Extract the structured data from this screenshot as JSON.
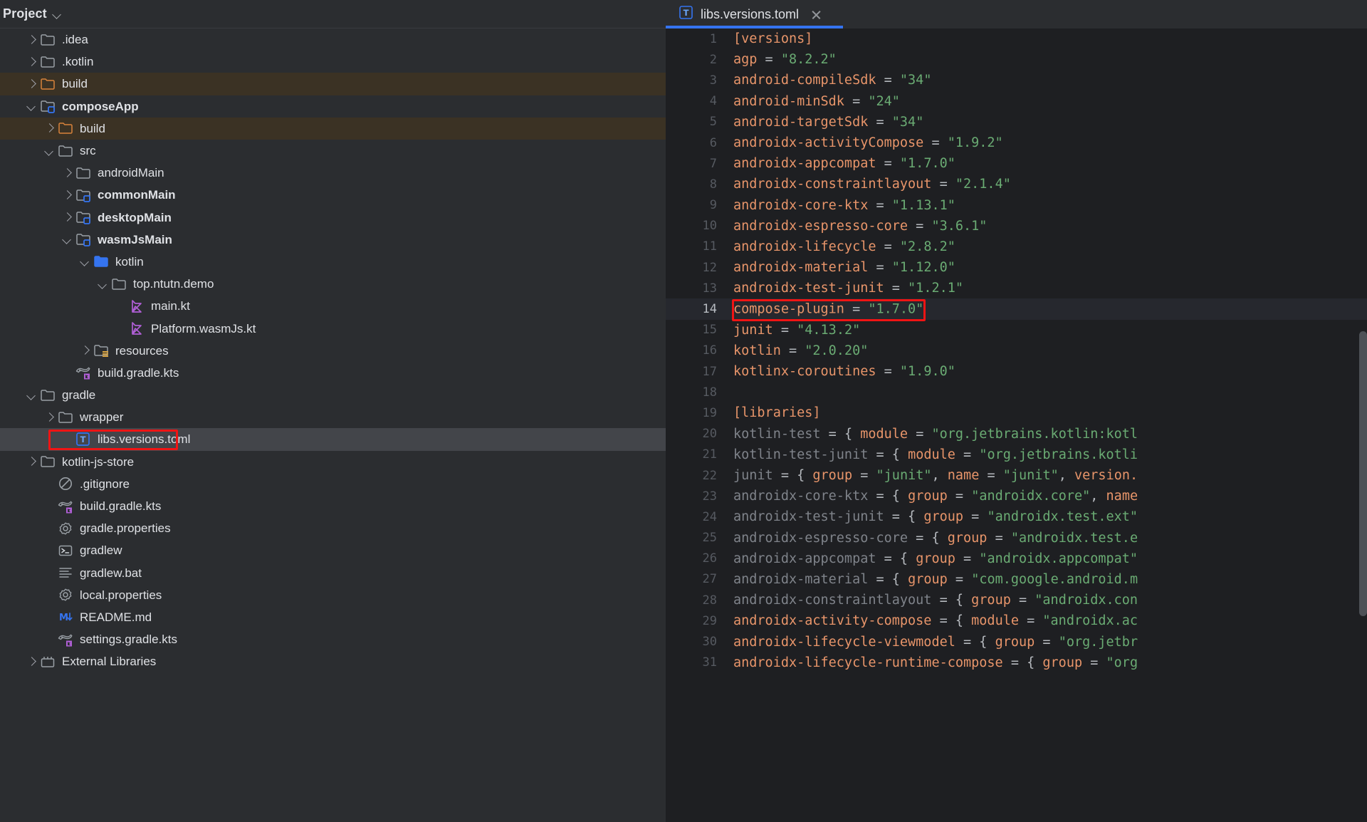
{
  "sidebar": {
    "header": {
      "title": "Project",
      "collapse_icon": "chevron-down-icon"
    },
    "items": [
      {
        "label": ".idea",
        "indent": 1,
        "arrow": "right",
        "icon": "folder",
        "bold": false,
        "state": "normal"
      },
      {
        "label": ".kotlin",
        "indent": 1,
        "arrow": "right",
        "icon": "folder",
        "bold": false,
        "state": "normal"
      },
      {
        "label": "build",
        "indent": 1,
        "arrow": "right",
        "icon": "folder-orange",
        "bold": false,
        "state": "build"
      },
      {
        "label": "composeApp",
        "indent": 1,
        "arrow": "down",
        "icon": "folder-module",
        "bold": true,
        "state": "normal"
      },
      {
        "label": "build",
        "indent": 2,
        "arrow": "right",
        "icon": "folder-orange",
        "bold": false,
        "state": "build"
      },
      {
        "label": "src",
        "indent": 2,
        "arrow": "down",
        "icon": "folder",
        "bold": false,
        "state": "normal"
      },
      {
        "label": "androidMain",
        "indent": 3,
        "arrow": "right",
        "icon": "folder",
        "bold": false,
        "state": "normal"
      },
      {
        "label": "commonMain",
        "indent": 3,
        "arrow": "right",
        "icon": "folder-module",
        "bold": true,
        "state": "normal"
      },
      {
        "label": "desktopMain",
        "indent": 3,
        "arrow": "right",
        "icon": "folder-module",
        "bold": true,
        "state": "normal"
      },
      {
        "label": "wasmJsMain",
        "indent": 3,
        "arrow": "down",
        "icon": "folder-module",
        "bold": true,
        "state": "normal"
      },
      {
        "label": "kotlin",
        "indent": 4,
        "arrow": "down",
        "icon": "folder-blue",
        "bold": false,
        "state": "normal"
      },
      {
        "label": "top.ntutn.demo",
        "indent": 5,
        "arrow": "down",
        "icon": "folder",
        "bold": false,
        "state": "normal"
      },
      {
        "label": "main.kt",
        "indent": 6,
        "arrow": "none",
        "icon": "kotlin-file",
        "bold": false,
        "state": "normal"
      },
      {
        "label": "Platform.wasmJs.kt",
        "indent": 6,
        "arrow": "none",
        "icon": "kotlin-file",
        "bold": false,
        "state": "normal"
      },
      {
        "label": "resources",
        "indent": 4,
        "arrow": "right",
        "icon": "folder-res",
        "bold": false,
        "state": "normal"
      },
      {
        "label": "build.gradle.kts",
        "indent": 3,
        "arrow": "none",
        "icon": "gradle-kts",
        "bold": false,
        "state": "normal"
      },
      {
        "label": "gradle",
        "indent": 1,
        "arrow": "down",
        "icon": "folder",
        "bold": false,
        "state": "normal"
      },
      {
        "label": "wrapper",
        "indent": 2,
        "arrow": "right",
        "icon": "folder",
        "bold": false,
        "state": "normal"
      },
      {
        "label": "libs.versions.toml",
        "indent": 3,
        "arrow": "none",
        "icon": "toml-file",
        "bold": false,
        "state": "selected"
      },
      {
        "label": "kotlin-js-store",
        "indent": 1,
        "arrow": "right",
        "icon": "folder",
        "bold": false,
        "state": "normal"
      },
      {
        "label": ".gitignore",
        "indent": 2,
        "arrow": "none",
        "icon": "gitignore",
        "bold": false,
        "state": "normal"
      },
      {
        "label": "build.gradle.kts",
        "indent": 2,
        "arrow": "none",
        "icon": "gradle-kts",
        "bold": false,
        "state": "normal"
      },
      {
        "label": "gradle.properties",
        "indent": 2,
        "arrow": "none",
        "icon": "properties",
        "bold": false,
        "state": "normal"
      },
      {
        "label": "gradlew",
        "indent": 2,
        "arrow": "none",
        "icon": "terminal-file",
        "bold": false,
        "state": "normal"
      },
      {
        "label": "gradlew.bat",
        "indent": 2,
        "arrow": "none",
        "icon": "text-file",
        "bold": false,
        "state": "normal"
      },
      {
        "label": "local.properties",
        "indent": 2,
        "arrow": "none",
        "icon": "properties",
        "bold": false,
        "state": "normal"
      },
      {
        "label": "README.md",
        "indent": 2,
        "arrow": "none",
        "icon": "markdown-file",
        "bold": false,
        "state": "normal"
      },
      {
        "label": "settings.gradle.kts",
        "indent": 2,
        "arrow": "none",
        "icon": "gradle-kts",
        "bold": false,
        "state": "normal"
      },
      {
        "label": "External Libraries",
        "indent": 1,
        "arrow": "right",
        "icon": "libraries",
        "bold": false,
        "state": "normal"
      }
    ]
  },
  "editor": {
    "tab": {
      "label": "libs.versions.toml",
      "icon": "toml-file-icon",
      "close_icon": "close-icon",
      "active": true
    },
    "accent_color": "#3574f0",
    "annotation_color": "#f01414",
    "active_line": 14,
    "lines": [
      {
        "n": 1,
        "tokens": [
          {
            "t": "[versions]",
            "c": "br"
          }
        ]
      },
      {
        "n": 2,
        "tokens": [
          {
            "t": "agp",
            "c": "k"
          },
          {
            "t": " = ",
            "c": "op"
          },
          {
            "t": "\"8.2.2\"",
            "c": "s"
          }
        ]
      },
      {
        "n": 3,
        "tokens": [
          {
            "t": "android-compileSdk",
            "c": "k"
          },
          {
            "t": " = ",
            "c": "op"
          },
          {
            "t": "\"34\"",
            "c": "s"
          }
        ]
      },
      {
        "n": 4,
        "tokens": [
          {
            "t": "android-minSdk",
            "c": "k"
          },
          {
            "t": " = ",
            "c": "op"
          },
          {
            "t": "\"24\"",
            "c": "s"
          }
        ]
      },
      {
        "n": 5,
        "tokens": [
          {
            "t": "android-targetSdk",
            "c": "k"
          },
          {
            "t": " = ",
            "c": "op"
          },
          {
            "t": "\"34\"",
            "c": "s"
          }
        ]
      },
      {
        "n": 6,
        "tokens": [
          {
            "t": "androidx-activityCompose",
            "c": "k"
          },
          {
            "t": " = ",
            "c": "op"
          },
          {
            "t": "\"1.9.2\"",
            "c": "s"
          }
        ]
      },
      {
        "n": 7,
        "tokens": [
          {
            "t": "androidx-appcompat",
            "c": "k"
          },
          {
            "t": " = ",
            "c": "op"
          },
          {
            "t": "\"1.7.0\"",
            "c": "s"
          }
        ]
      },
      {
        "n": 8,
        "tokens": [
          {
            "t": "androidx-constraintlayout",
            "c": "k"
          },
          {
            "t": " = ",
            "c": "op"
          },
          {
            "t": "\"2.1.4\"",
            "c": "s"
          }
        ]
      },
      {
        "n": 9,
        "tokens": [
          {
            "t": "androidx-core-ktx",
            "c": "k"
          },
          {
            "t": " = ",
            "c": "op"
          },
          {
            "t": "\"1.13.1\"",
            "c": "s"
          }
        ]
      },
      {
        "n": 10,
        "tokens": [
          {
            "t": "androidx-espresso-core",
            "c": "k"
          },
          {
            "t": " = ",
            "c": "op"
          },
          {
            "t": "\"3.6.1\"",
            "c": "s"
          }
        ]
      },
      {
        "n": 11,
        "tokens": [
          {
            "t": "androidx-lifecycle",
            "c": "k"
          },
          {
            "t": " = ",
            "c": "op"
          },
          {
            "t": "\"2.8.2\"",
            "c": "s"
          }
        ]
      },
      {
        "n": 12,
        "tokens": [
          {
            "t": "androidx-material",
            "c": "k"
          },
          {
            "t": " = ",
            "c": "op"
          },
          {
            "t": "\"1.12.0\"",
            "c": "s"
          }
        ]
      },
      {
        "n": 13,
        "tokens": [
          {
            "t": "androidx-test-junit",
            "c": "k"
          },
          {
            "t": " = ",
            "c": "op"
          },
          {
            "t": "\"1.2.1\"",
            "c": "s"
          }
        ]
      },
      {
        "n": 14,
        "tokens": [
          {
            "t": "compose-plugin",
            "c": "k"
          },
          {
            "t": " = ",
            "c": "op"
          },
          {
            "t": "\"1.7.0\"",
            "c": "s"
          }
        ],
        "caret_after": "1.7.0",
        "annotated": true
      },
      {
        "n": 15,
        "tokens": [
          {
            "t": "junit",
            "c": "k"
          },
          {
            "t": " = ",
            "c": "op"
          },
          {
            "t": "\"4.13.2\"",
            "c": "s"
          }
        ]
      },
      {
        "n": 16,
        "tokens": [
          {
            "t": "kotlin",
            "c": "k"
          },
          {
            "t": " = ",
            "c": "op"
          },
          {
            "t": "\"2.0.20\"",
            "c": "s"
          }
        ]
      },
      {
        "n": 17,
        "tokens": [
          {
            "t": "kotlinx-coroutines",
            "c": "k"
          },
          {
            "t": " = ",
            "c": "op"
          },
          {
            "t": "\"1.9.0\"",
            "c": "s"
          }
        ]
      },
      {
        "n": 18,
        "tokens": []
      },
      {
        "n": 19,
        "tokens": [
          {
            "t": "[libraries]",
            "c": "br"
          }
        ]
      },
      {
        "n": 20,
        "tokens": [
          {
            "t": "kotlin-test",
            "c": "kd"
          },
          {
            "t": " = { ",
            "c": "op"
          },
          {
            "t": "module",
            "c": "k"
          },
          {
            "t": " = ",
            "c": "op"
          },
          {
            "t": "\"org.jetbrains.kotlin:kotl",
            "c": "s"
          }
        ]
      },
      {
        "n": 21,
        "tokens": [
          {
            "t": "kotlin-test-junit",
            "c": "kd"
          },
          {
            "t": " = { ",
            "c": "op"
          },
          {
            "t": "module",
            "c": "k"
          },
          {
            "t": " = ",
            "c": "op"
          },
          {
            "t": "\"org.jetbrains.kotli",
            "c": "s"
          }
        ]
      },
      {
        "n": 22,
        "tokens": [
          {
            "t": "junit",
            "c": "kd"
          },
          {
            "t": " = { ",
            "c": "op"
          },
          {
            "t": "group",
            "c": "k"
          },
          {
            "t": " = ",
            "c": "op"
          },
          {
            "t": "\"junit\"",
            "c": "s"
          },
          {
            "t": ", ",
            "c": "op"
          },
          {
            "t": "name",
            "c": "k"
          },
          {
            "t": " = ",
            "c": "op"
          },
          {
            "t": "\"junit\"",
            "c": "s"
          },
          {
            "t": ", ",
            "c": "op"
          },
          {
            "t": "version.",
            "c": "k"
          }
        ]
      },
      {
        "n": 23,
        "tokens": [
          {
            "t": "androidx-core-ktx",
            "c": "kd"
          },
          {
            "t": " = { ",
            "c": "op"
          },
          {
            "t": "group",
            "c": "k"
          },
          {
            "t": " = ",
            "c": "op"
          },
          {
            "t": "\"androidx.core\"",
            "c": "s"
          },
          {
            "t": ", ",
            "c": "op"
          },
          {
            "t": "name",
            "c": "k"
          }
        ]
      },
      {
        "n": 24,
        "tokens": [
          {
            "t": "androidx-test-junit",
            "c": "kd"
          },
          {
            "t": " = { ",
            "c": "op"
          },
          {
            "t": "group",
            "c": "k"
          },
          {
            "t": " = ",
            "c": "op"
          },
          {
            "t": "\"androidx.test.ext\"",
            "c": "s"
          }
        ]
      },
      {
        "n": 25,
        "tokens": [
          {
            "t": "androidx-espresso-core",
            "c": "kd"
          },
          {
            "t": " = { ",
            "c": "op"
          },
          {
            "t": "group",
            "c": "k"
          },
          {
            "t": " = ",
            "c": "op"
          },
          {
            "t": "\"androidx.test.e",
            "c": "s"
          }
        ]
      },
      {
        "n": 26,
        "tokens": [
          {
            "t": "androidx-appcompat",
            "c": "kd"
          },
          {
            "t": " = { ",
            "c": "op"
          },
          {
            "t": "group",
            "c": "k"
          },
          {
            "t": " = ",
            "c": "op"
          },
          {
            "t": "\"androidx.appcompat\"",
            "c": "s"
          }
        ]
      },
      {
        "n": 27,
        "tokens": [
          {
            "t": "androidx-material",
            "c": "kd"
          },
          {
            "t": " = { ",
            "c": "op"
          },
          {
            "t": "group",
            "c": "k"
          },
          {
            "t": " = ",
            "c": "op"
          },
          {
            "t": "\"com.google.android.m",
            "c": "s"
          }
        ]
      },
      {
        "n": 28,
        "tokens": [
          {
            "t": "androidx-constraintlayout",
            "c": "kd"
          },
          {
            "t": " = { ",
            "c": "op"
          },
          {
            "t": "group",
            "c": "k"
          },
          {
            "t": " = ",
            "c": "op"
          },
          {
            "t": "\"androidx.con",
            "c": "s"
          }
        ]
      },
      {
        "n": 29,
        "tokens": [
          {
            "t": "androidx-activity-compose",
            "c": "k"
          },
          {
            "t": " = { ",
            "c": "op"
          },
          {
            "t": "module",
            "c": "k"
          },
          {
            "t": " = ",
            "c": "op"
          },
          {
            "t": "\"androidx.ac",
            "c": "s"
          }
        ]
      },
      {
        "n": 30,
        "tokens": [
          {
            "t": "androidx-lifecycle-viewmodel",
            "c": "k"
          },
          {
            "t": " = { ",
            "c": "op"
          },
          {
            "t": "group",
            "c": "k"
          },
          {
            "t": " = ",
            "c": "op"
          },
          {
            "t": "\"org.jetbr",
            "c": "s"
          }
        ]
      },
      {
        "n": 31,
        "tokens": [
          {
            "t": "androidx-lifecycle-runtime-compose",
            "c": "k"
          },
          {
            "t": " = { ",
            "c": "op"
          },
          {
            "t": "group",
            "c": "k"
          },
          {
            "t": " = ",
            "c": "op"
          },
          {
            "t": "\"org",
            "c": "s"
          }
        ]
      }
    ]
  }
}
